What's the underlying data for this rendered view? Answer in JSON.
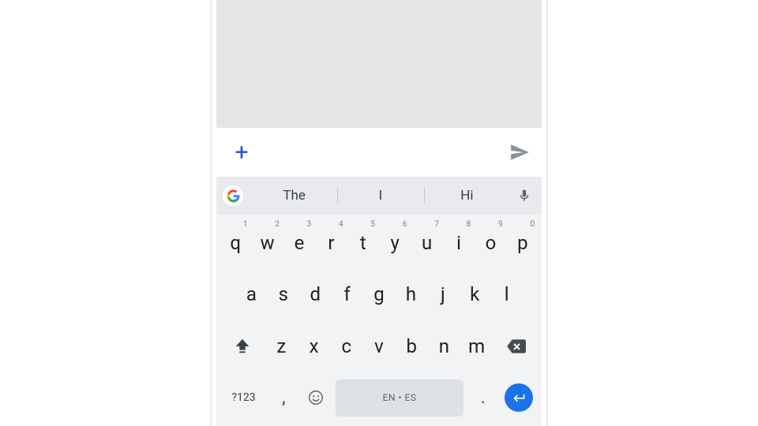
{
  "compose": {
    "plus": "+"
  },
  "suggestions": [
    "The",
    "I",
    "Hi"
  ],
  "keyboard": {
    "row1": [
      {
        "k": "q",
        "h": "1"
      },
      {
        "k": "w",
        "h": "2"
      },
      {
        "k": "e",
        "h": "3"
      },
      {
        "k": "r",
        "h": "4"
      },
      {
        "k": "t",
        "h": "5"
      },
      {
        "k": "y",
        "h": "6"
      },
      {
        "k": "u",
        "h": "7"
      },
      {
        "k": "i",
        "h": "8"
      },
      {
        "k": "o",
        "h": "9"
      },
      {
        "k": "p",
        "h": "0"
      }
    ],
    "row2": [
      "a",
      "s",
      "d",
      "f",
      "g",
      "h",
      "j",
      "k",
      "l"
    ],
    "row3": [
      "z",
      "x",
      "c",
      "v",
      "b",
      "n",
      "m"
    ],
    "switch_label": "?123",
    "comma": ",",
    "period": ".",
    "space_label": "EN • ES"
  }
}
